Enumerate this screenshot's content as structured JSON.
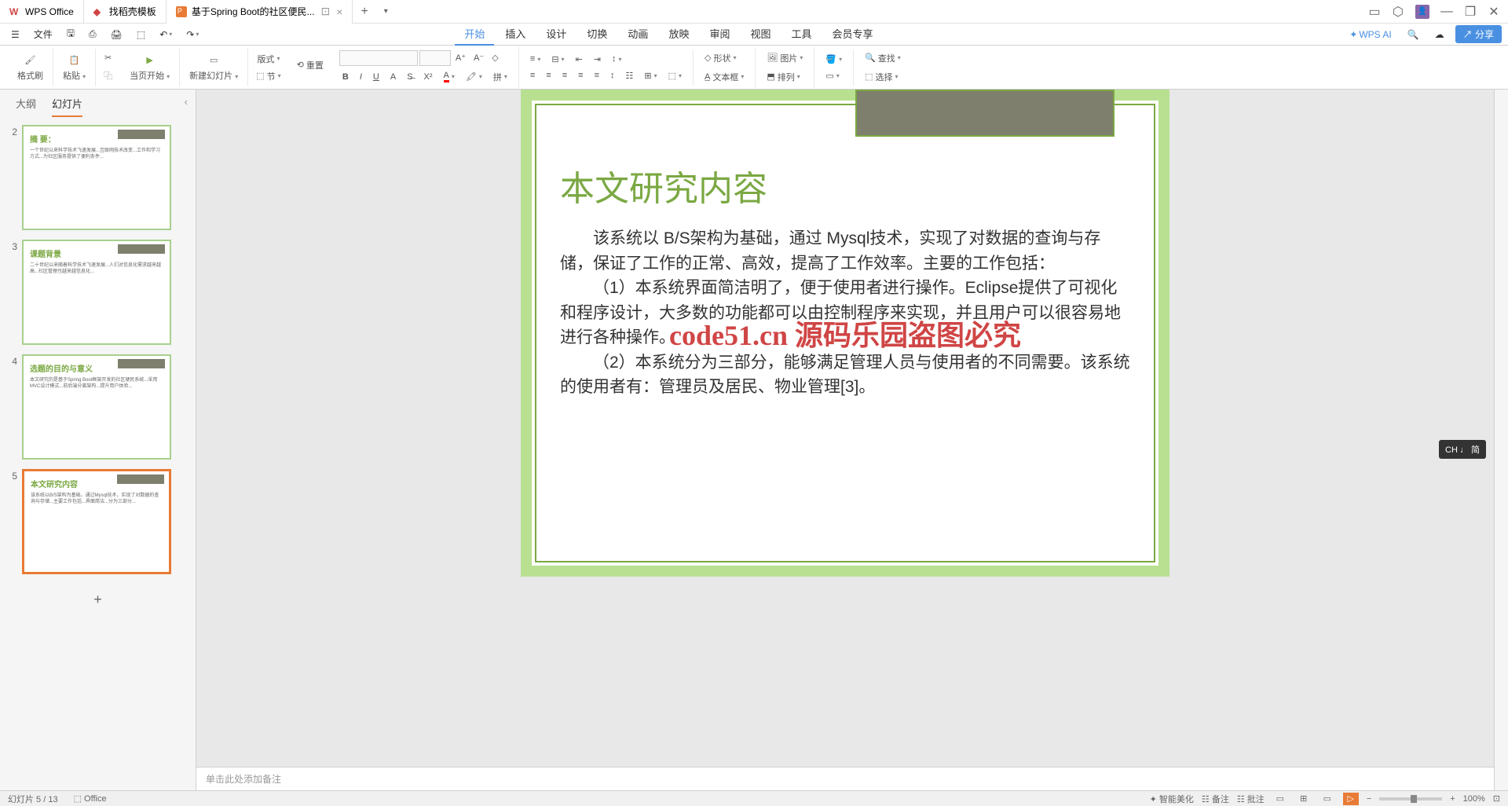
{
  "titlebar": {
    "tabs": [
      {
        "icon": "wps",
        "label": "WPS Office"
      },
      {
        "icon": "dao",
        "label": "找稻壳模板"
      },
      {
        "icon": "ppt",
        "label": "基于Spring Boot的社区便民..."
      }
    ]
  },
  "menubar": {
    "file": "文件",
    "tabs": [
      "开始",
      "插入",
      "设计",
      "切换",
      "动画",
      "放映",
      "审阅",
      "视图",
      "工具",
      "会员专享"
    ],
    "active_tab": "开始",
    "wps_ai": "WPS AI",
    "share": "分享"
  },
  "ribbon": {
    "format_painter": "格式刷",
    "paste": "粘贴",
    "start_page": "当页开始",
    "new_slide": "新建幻灯片",
    "layout": "版式",
    "section": "节",
    "reset": "重置",
    "shape": "形状",
    "image": "图片",
    "textbox": "文本框",
    "arrange": "排列",
    "find": "查找",
    "select": "选择"
  },
  "sidepanel": {
    "tab_outline": "大纲",
    "tab_slides": "幻灯片",
    "thumbs": [
      {
        "num": "2",
        "title": "摘   要：",
        "selected": false
      },
      {
        "num": "3",
        "title": "课题背景",
        "selected": false
      },
      {
        "num": "4",
        "title": "选题的目的与意义",
        "selected": false
      },
      {
        "num": "5",
        "title": "本文研究内容",
        "selected": true
      }
    ]
  },
  "slide": {
    "title": "本文研究内容",
    "body_p1": "该系统以 B/S架构为基础，通过 Mysql技术，实现了对数据的查询与存储，保证了工作的正常、高效，提高了工作效率。主要的工作包括：",
    "body_p2": "（1）本系统界面简洁明了，便于使用者进行操作。Eclipse提供了可视化和程序设计，大多数的功能都可以由控制程序来实现，并且用户可以很容易地进行各种操作。",
    "body_p3": "（2）本系统分为三部分，能够满足管理人员与使用者的不同需要。该系统的使用者有：管理员及居民、物业管理[3]。",
    "watermark": "code51.cn 源码乐园盗图必究"
  },
  "notes": {
    "placeholder": "单击此处添加备注"
  },
  "statusbar": {
    "slide_info": "幻灯片 5 / 13",
    "office": "Office",
    "auto_beautify": "智能美化",
    "notes_btn": "备注",
    "zoom": "100%"
  },
  "ime": {
    "label": "CH ♩ 简"
  }
}
